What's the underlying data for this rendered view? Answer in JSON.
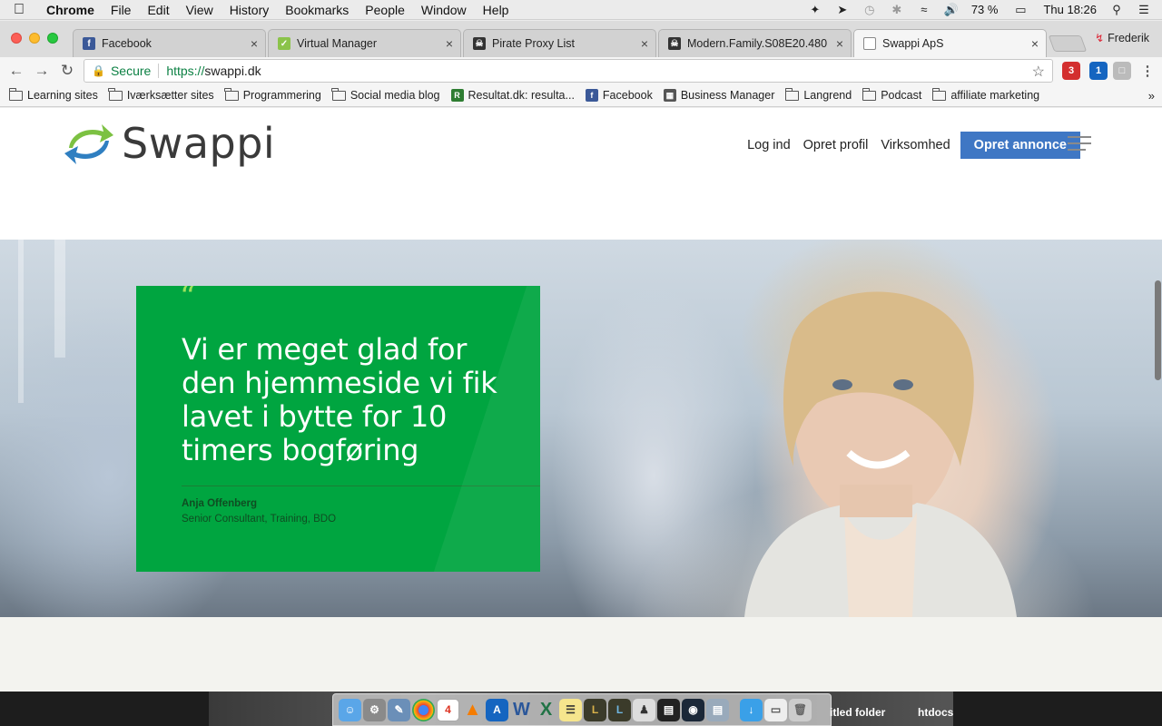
{
  "menubar": {
    "app": "Chrome",
    "items": [
      "File",
      "Edit",
      "View",
      "History",
      "Bookmarks",
      "People",
      "Window",
      "Help"
    ],
    "battery": "73 %",
    "clock": "Thu 18:26"
  },
  "tabs": [
    {
      "title": "Facebook",
      "icon": "facebook-icon",
      "color": "#3b5998"
    },
    {
      "title": "Virtual Manager",
      "icon": "virtual-manager-icon",
      "color": "#8bc34a"
    },
    {
      "title": "Pirate Proxy List",
      "icon": "pirate-icon",
      "color": "#333333"
    },
    {
      "title": "Modern.Family.S08E20.480",
      "icon": "pirate-icon",
      "color": "#333333"
    },
    {
      "title": "Swappi ApS",
      "icon": "page-icon",
      "color": "#ffffff"
    }
  ],
  "profile": "Frederik",
  "address": {
    "secure_label": "Secure",
    "scheme": "https://",
    "host": "swappi.dk"
  },
  "extensions": [
    {
      "badge": "3",
      "color": "#d32f2f"
    },
    {
      "badge": "1",
      "color": "#1565c0"
    }
  ],
  "bookmarks": [
    {
      "label": "Learning sites",
      "type": "folder"
    },
    {
      "label": "Iværksætter sites",
      "type": "folder"
    },
    {
      "label": "Programmering",
      "type": "folder"
    },
    {
      "label": "Social media blog",
      "type": "folder"
    },
    {
      "label": "Resultat.dk: resulta...",
      "type": "site",
      "color": "#2e7d32"
    },
    {
      "label": "Facebook",
      "type": "site",
      "color": "#3b5998"
    },
    {
      "label": "Business Manager",
      "type": "site",
      "color": "#555555"
    },
    {
      "label": "Langrend",
      "type": "folder"
    },
    {
      "label": "Podcast",
      "type": "folder"
    },
    {
      "label": "affiliate marketing",
      "type": "folder"
    }
  ],
  "site": {
    "logo_text": "Swappi",
    "nav": {
      "login": "Log ind",
      "create_profile": "Opret profil",
      "business": "Virksomhed",
      "cta": "Opret annonce"
    },
    "hero": {
      "quote_mark": "“",
      "quote": "Vi er meget glad for den hjemmeside vi fik lavet i bytte for 10 timers bogføring",
      "author": "Anja Offenberg",
      "role": "Senior Consultant, Training, BDO"
    },
    "colors": {
      "brand_green": "#00a540",
      "cta_blue": "#3f77c4"
    }
  },
  "desktop": {
    "label_left": "itled folder",
    "label_right": "htdocs"
  }
}
